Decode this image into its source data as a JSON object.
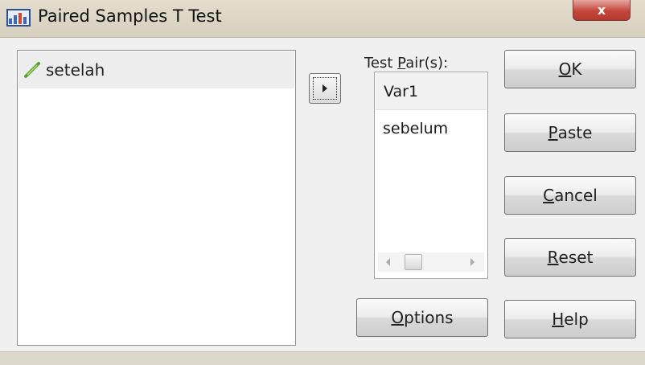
{
  "window": {
    "title": "Paired Samples T Test",
    "close_label": "x"
  },
  "source_list": {
    "items": [
      {
        "label": "setelah",
        "icon": "ruler-icon"
      }
    ]
  },
  "move_button": {
    "icon": "right-arrow-icon"
  },
  "test_pairs": {
    "label_prefix": "Test ",
    "label_mnemonic": "P",
    "label_suffix": "air(s):",
    "header": "Var1",
    "rows": [
      "sebelum"
    ]
  },
  "buttons": {
    "ok": {
      "mnemonic": "O",
      "rest": "K"
    },
    "paste": {
      "mnemonic": "P",
      "rest": "aste"
    },
    "cancel": {
      "mnemonic": "C",
      "rest": "ancel"
    },
    "reset": {
      "mnemonic": "R",
      "rest": "eset"
    },
    "options": {
      "mnemonic": "O",
      "rest": "ptions"
    },
    "help": {
      "mnemonic": "H",
      "rest": "elp"
    }
  }
}
